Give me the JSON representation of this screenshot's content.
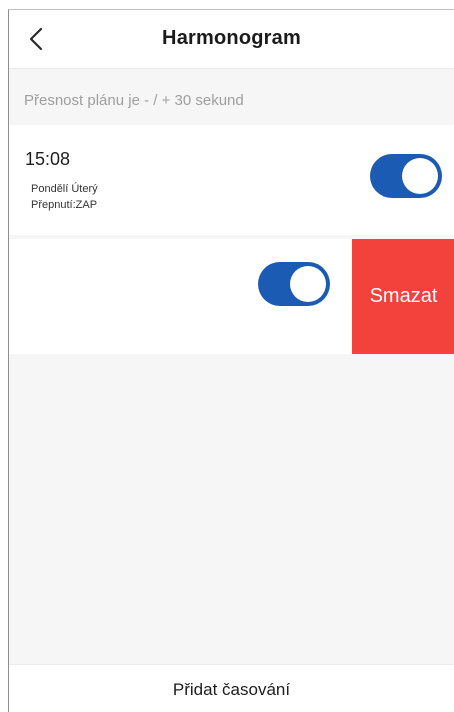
{
  "header": {
    "title": "Harmonogram",
    "back_icon": "chevron-left-icon"
  },
  "accuracy_note": "Přesnost plánu je - / + 30 sekund",
  "schedules": [
    {
      "time": "15:08",
      "days": "Pondělí Úterý",
      "state": "Přepnutí:ZAP",
      "enabled": true
    },
    {
      "time": "",
      "days": "",
      "state": "",
      "enabled": true
    }
  ],
  "delete_label": "Smazat",
  "footer": {
    "add_label": "Přidat časování"
  },
  "colors": {
    "toggle_on": "#1c5bb4",
    "delete": "#f2423b",
    "background": "#f6f6f6"
  }
}
